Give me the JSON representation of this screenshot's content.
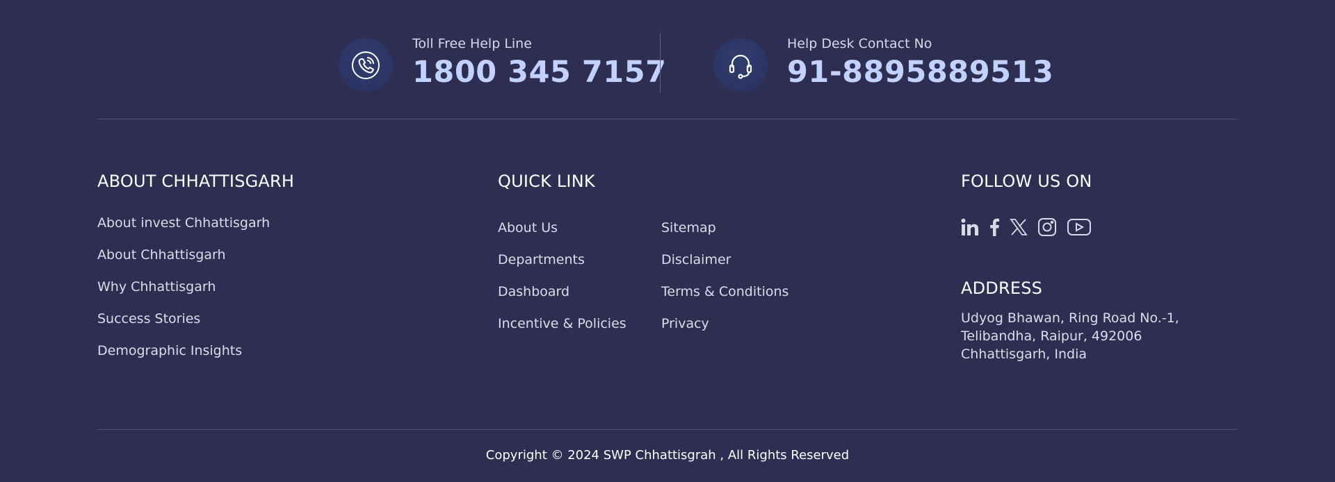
{
  "helpline": {
    "toll_free": {
      "label": "Toll Free Help Line",
      "number": "1800 345 7157",
      "icon": "phone-icon"
    },
    "help_desk": {
      "label": "Help Desk Contact No",
      "number": "91-8895889513",
      "icon": "headset-icon"
    }
  },
  "about": {
    "title": "ABOUT CHHATTISGARH",
    "links": [
      "About invest Chhattisgarh",
      "About Chhattisgarh",
      "Why Chhattisgarh",
      "Success Stories",
      "Demographic Insights"
    ]
  },
  "quick_link": {
    "title": "QUICK LINK",
    "col1": [
      "About Us",
      "Departments",
      "Dashboard",
      "Incentive & Policies"
    ],
    "col2": [
      "Sitemap",
      "Disclaimer",
      "Terms & Conditions",
      "Privacy"
    ]
  },
  "follow": {
    "title": "FOLLOW US ON",
    "icons": [
      "linkedin-icon",
      "facebook-icon",
      "x-icon",
      "instagram-icon",
      "youtube-icon"
    ]
  },
  "address": {
    "title": "ADDRESS",
    "lines": [
      "Udyog Bhawan, Ring Road No.-1,",
      "Telibandha, Raipur, 492006",
      "Chhattisgarh, India"
    ]
  },
  "footer": {
    "copyright": "Copyright © 2024 SWP Chhattisgrah , All Rights Reserved"
  },
  "colors": {
    "background": "#2e2e52",
    "accent_number": "#c3d1ff",
    "divider": "#4f5178"
  }
}
